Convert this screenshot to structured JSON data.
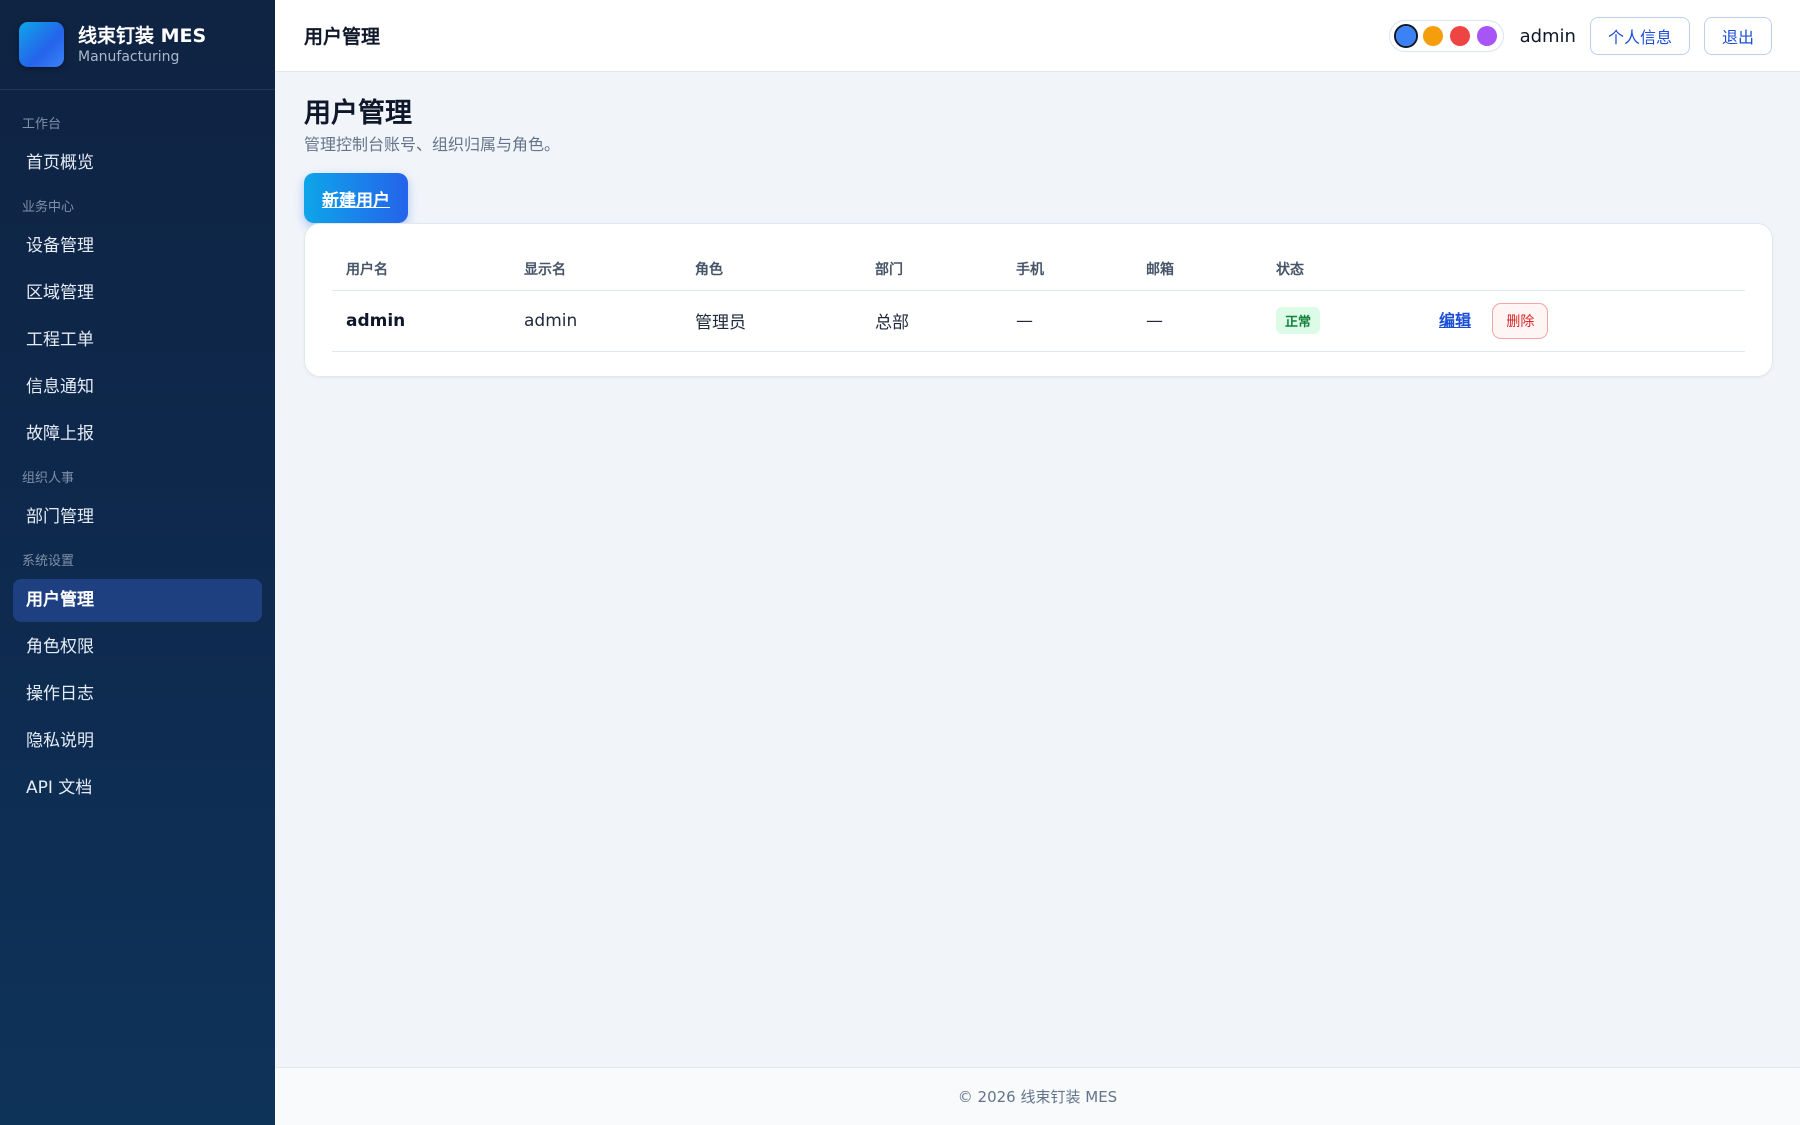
{
  "brand": {
    "name": "线束钉装 MES",
    "subtitle": "Manufacturing"
  },
  "sidebar": {
    "groups": [
      {
        "title": "工作台",
        "items": [
          "首页概览"
        ]
      },
      {
        "title": "业务中心",
        "items": [
          "设备管理",
          "区域管理",
          "工程工单",
          "信息通知",
          "故障上报"
        ]
      },
      {
        "title": "组织人事",
        "items": [
          "部门管理"
        ]
      },
      {
        "title": "系统设置",
        "items": [
          "用户管理",
          "角色权限",
          "操作日志",
          "隐私说明",
          "API 文档"
        ]
      }
    ],
    "active_item": "用户管理"
  },
  "header": {
    "title": "用户管理",
    "theme_colors": [
      "#3b82f6",
      "#f59e0b",
      "#ef4444",
      "#a855f7"
    ],
    "username": "admin",
    "profile_label": "个人信息",
    "logout_label": "退出"
  },
  "page": {
    "title": "用户管理",
    "description": "管理控制台账号、组织归属与角色。",
    "new_user_label": "新建用户"
  },
  "table": {
    "columns": [
      "用户名",
      "显示名",
      "角色",
      "部门",
      "手机",
      "邮箱",
      "状态"
    ],
    "rows": [
      {
        "username": "admin",
        "display_name": "admin",
        "role": "管理员",
        "department": "总部",
        "phone": "—",
        "email": "—",
        "status": "正常",
        "edit_label": "编辑",
        "delete_label": "删除"
      }
    ]
  },
  "footer": {
    "text": "© 2026 线束钉装 MES"
  }
}
